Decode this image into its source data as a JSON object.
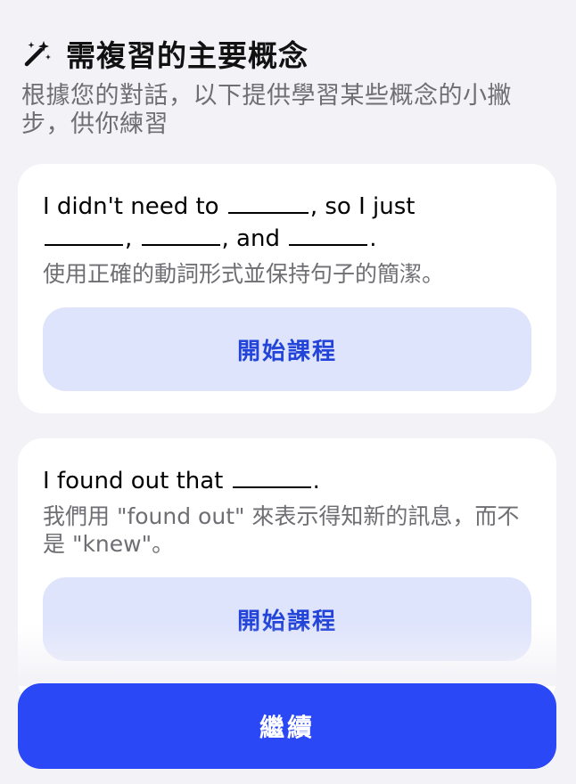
{
  "header": {
    "title": "需複習的主要概念",
    "subtitle": "根據您的對話，以下提供學習某些概念的小撇步，供你練習"
  },
  "cards": [
    {
      "sentence_part1": "I didn't need to",
      "sentence_part2": ", so I just",
      "sentence_part3": ",",
      "sentence_part4": ", and",
      "sentence_part5": ".",
      "explanation": "使用正確的動詞形式並保持句子的簡潔。",
      "button_label": "開始課程"
    },
    {
      "sentence_part1": "I found out that",
      "sentence_part2": ".",
      "explanation": "我們用 \"found out\" 來表示得知新的訊息，而不是 \"knew\"。",
      "button_label": "開始課程"
    }
  ],
  "footer": {
    "continue_label": "繼續"
  },
  "colors": {
    "primary": "#2a48f5",
    "lesson_button_bg": "#dfe4fd",
    "lesson_button_text": "#2344d8"
  },
  "icons": {
    "header": "magic-wand-icon"
  }
}
